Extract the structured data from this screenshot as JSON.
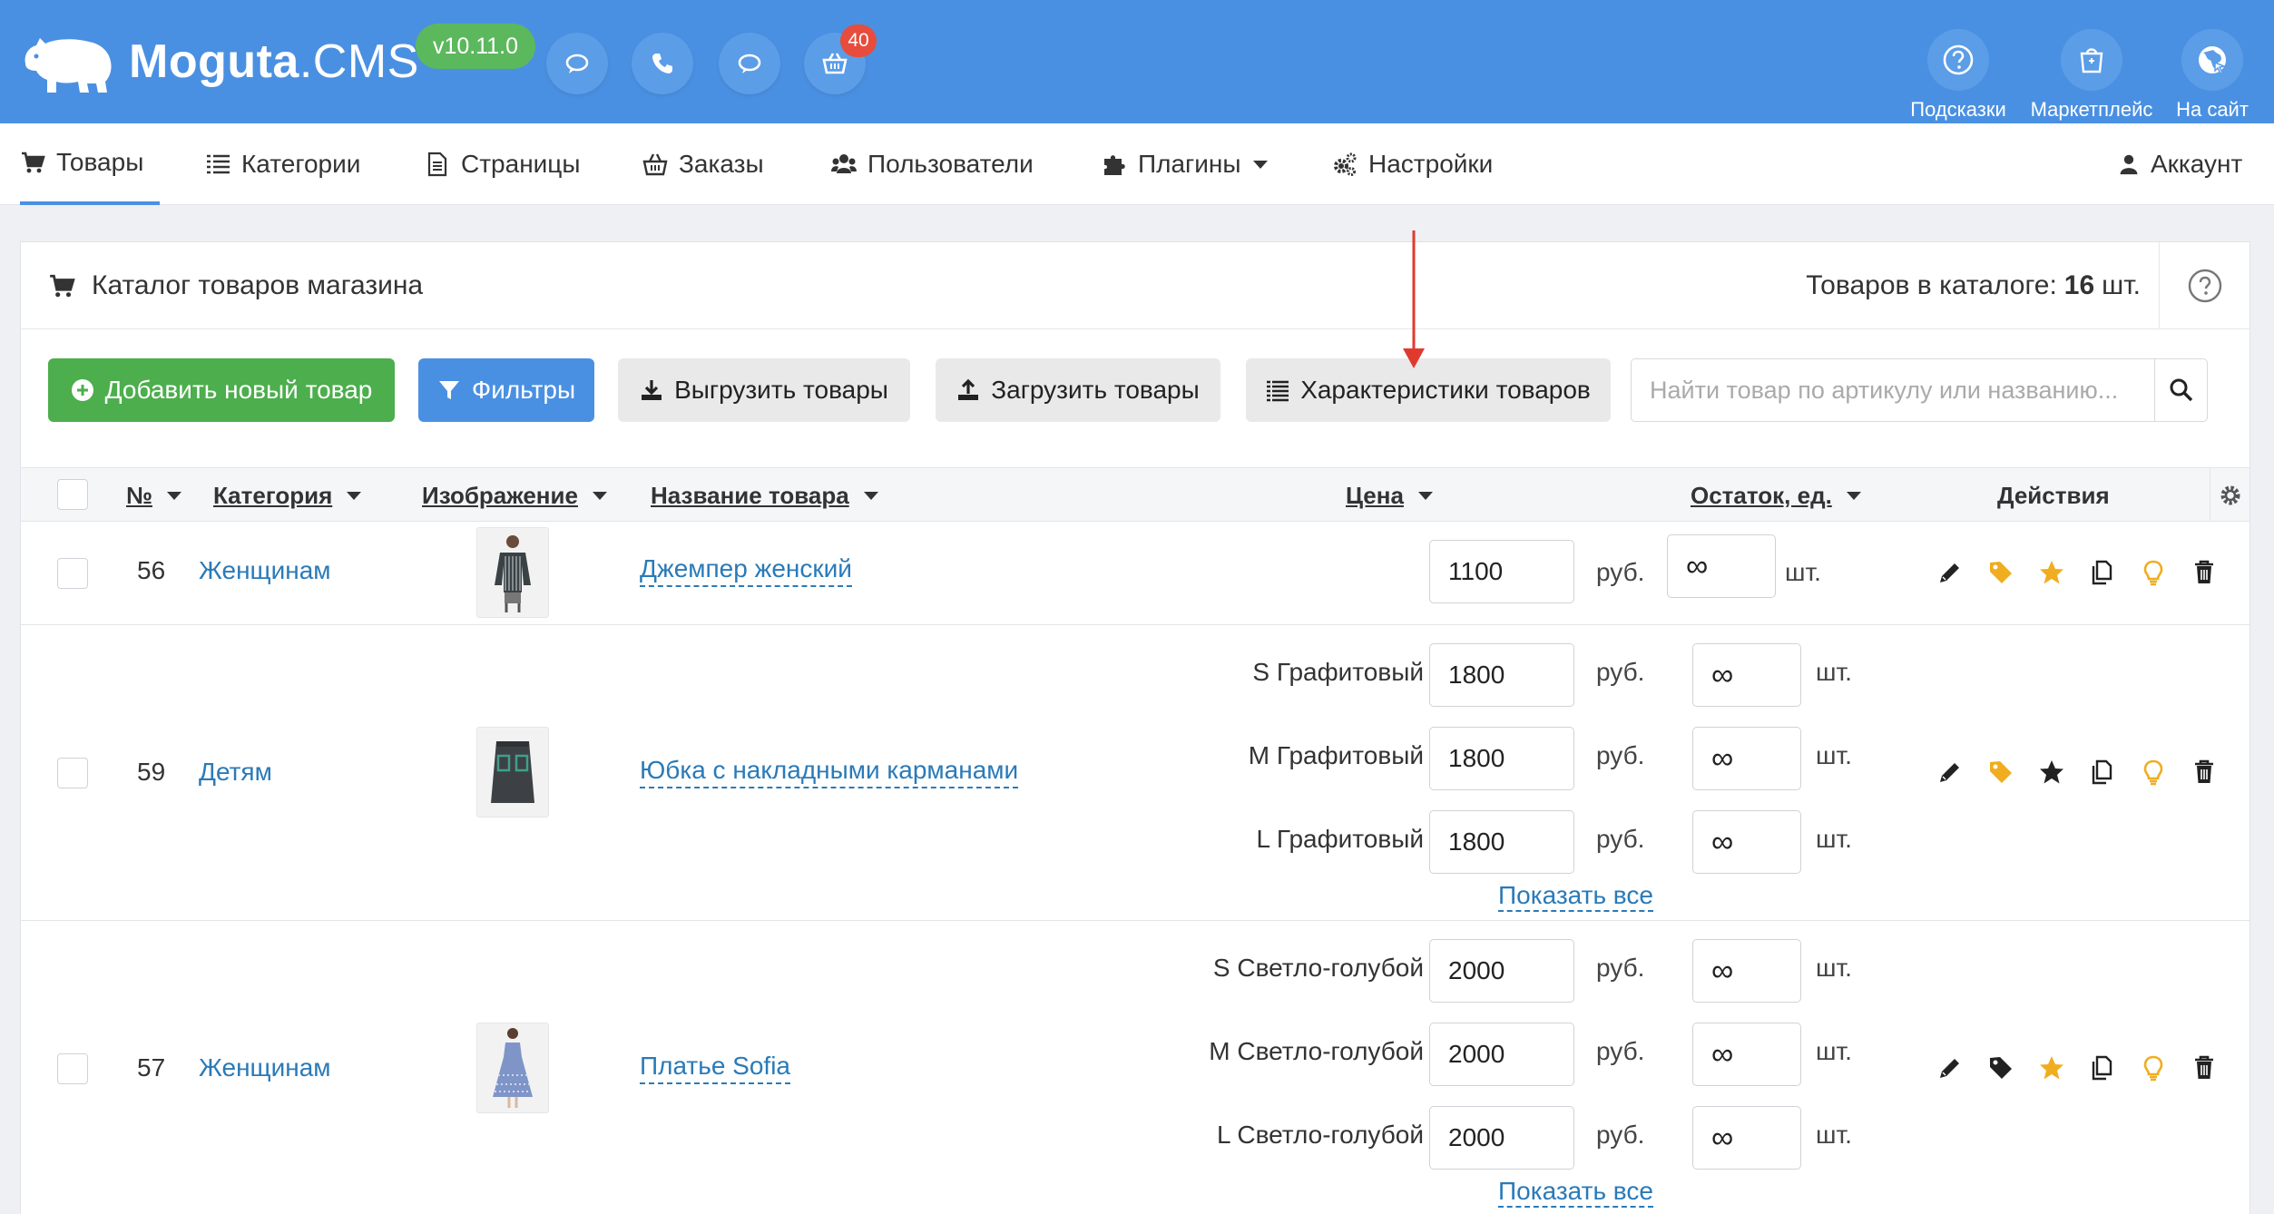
{
  "header": {
    "logo_bold": "Moguta",
    "logo_light": ".CMS",
    "version": "v10.11.0",
    "cart_count": "40",
    "right": [
      {
        "label": "Подсказки",
        "icon": "question-icon"
      },
      {
        "label": "Маркетплейс",
        "icon": "shopping-bag-icon"
      },
      {
        "label": "На сайт",
        "icon": "globe-icon"
      }
    ]
  },
  "nav": {
    "items": [
      {
        "label": "Товары",
        "icon": "cart-icon",
        "active": true
      },
      {
        "label": "Категории",
        "icon": "list-icon"
      },
      {
        "label": "Страницы",
        "icon": "page-icon"
      },
      {
        "label": "Заказы",
        "icon": "basket-icon"
      },
      {
        "label": "Пользователи",
        "icon": "users-icon"
      },
      {
        "label": "Плагины",
        "icon": "puzzle-icon",
        "dropdown": true
      },
      {
        "label": "Настройки",
        "icon": "gears-icon"
      }
    ],
    "account": "Аккаунт"
  },
  "panel": {
    "title": "Каталог товаров магазина",
    "count_prefix": "Товаров в каталоге:",
    "count_value": "16",
    "count_suffix": "шт."
  },
  "toolbar": {
    "add": "Добавить новый товар",
    "filters": "Фильтры",
    "export": "Выгрузить товары",
    "import": "Загрузить товары",
    "characteristics": "Характеристики товаров",
    "search_placeholder": "Найти товар по артикулу или названию..."
  },
  "table": {
    "columns": {
      "num": "№",
      "category": "Категория",
      "image": "Изображение",
      "name": "Название товара",
      "price": "Цена",
      "stock": "Остаток, ед.",
      "actions": "Действия"
    },
    "currency": "руб.",
    "unit": "шт.",
    "infinity": "∞",
    "show_all": "Показать все",
    "rows": [
      {
        "num": "56",
        "category": "Женщинам",
        "name": "Джемпер женский",
        "image": "sweater-thumb",
        "price": "1100",
        "stock": "∞",
        "tag_color": "#f0ad1f",
        "star_color": "#f0ad1f"
      },
      {
        "num": "59",
        "category": "Детям",
        "name": "Юбка с накладными карманами",
        "image": "skirt-thumb",
        "tag_color": "#f0ad1f",
        "star_color": "#222222",
        "variants": [
          {
            "label": "S Графитовый",
            "price": "1800",
            "stock": "∞"
          },
          {
            "label": "M Графитовый",
            "price": "1800",
            "stock": "∞"
          },
          {
            "label": "L Графитовый",
            "price": "1800",
            "stock": "∞"
          }
        ]
      },
      {
        "num": "57",
        "category": "Женщинам",
        "name": "Платье Sofia",
        "image": "dress-thumb",
        "tag_color": "#222222",
        "star_color": "#f0ad1f",
        "variants": [
          {
            "label": "S Светло-голубой",
            "price": "2000",
            "stock": "∞"
          },
          {
            "label": "M Светло-голубой",
            "price": "2000",
            "stock": "∞"
          },
          {
            "label": "L Светло-голубой",
            "price": "2000",
            "stock": "∞"
          }
        ]
      }
    ]
  },
  "colors": {
    "header_bg": "#4a90e2",
    "version_badge": "#5cb85c",
    "cart_badge": "#e74c3c",
    "add_button": "#4cae4c",
    "link": "#2a7ab8",
    "annotation_arrow": "#e03a2e"
  }
}
